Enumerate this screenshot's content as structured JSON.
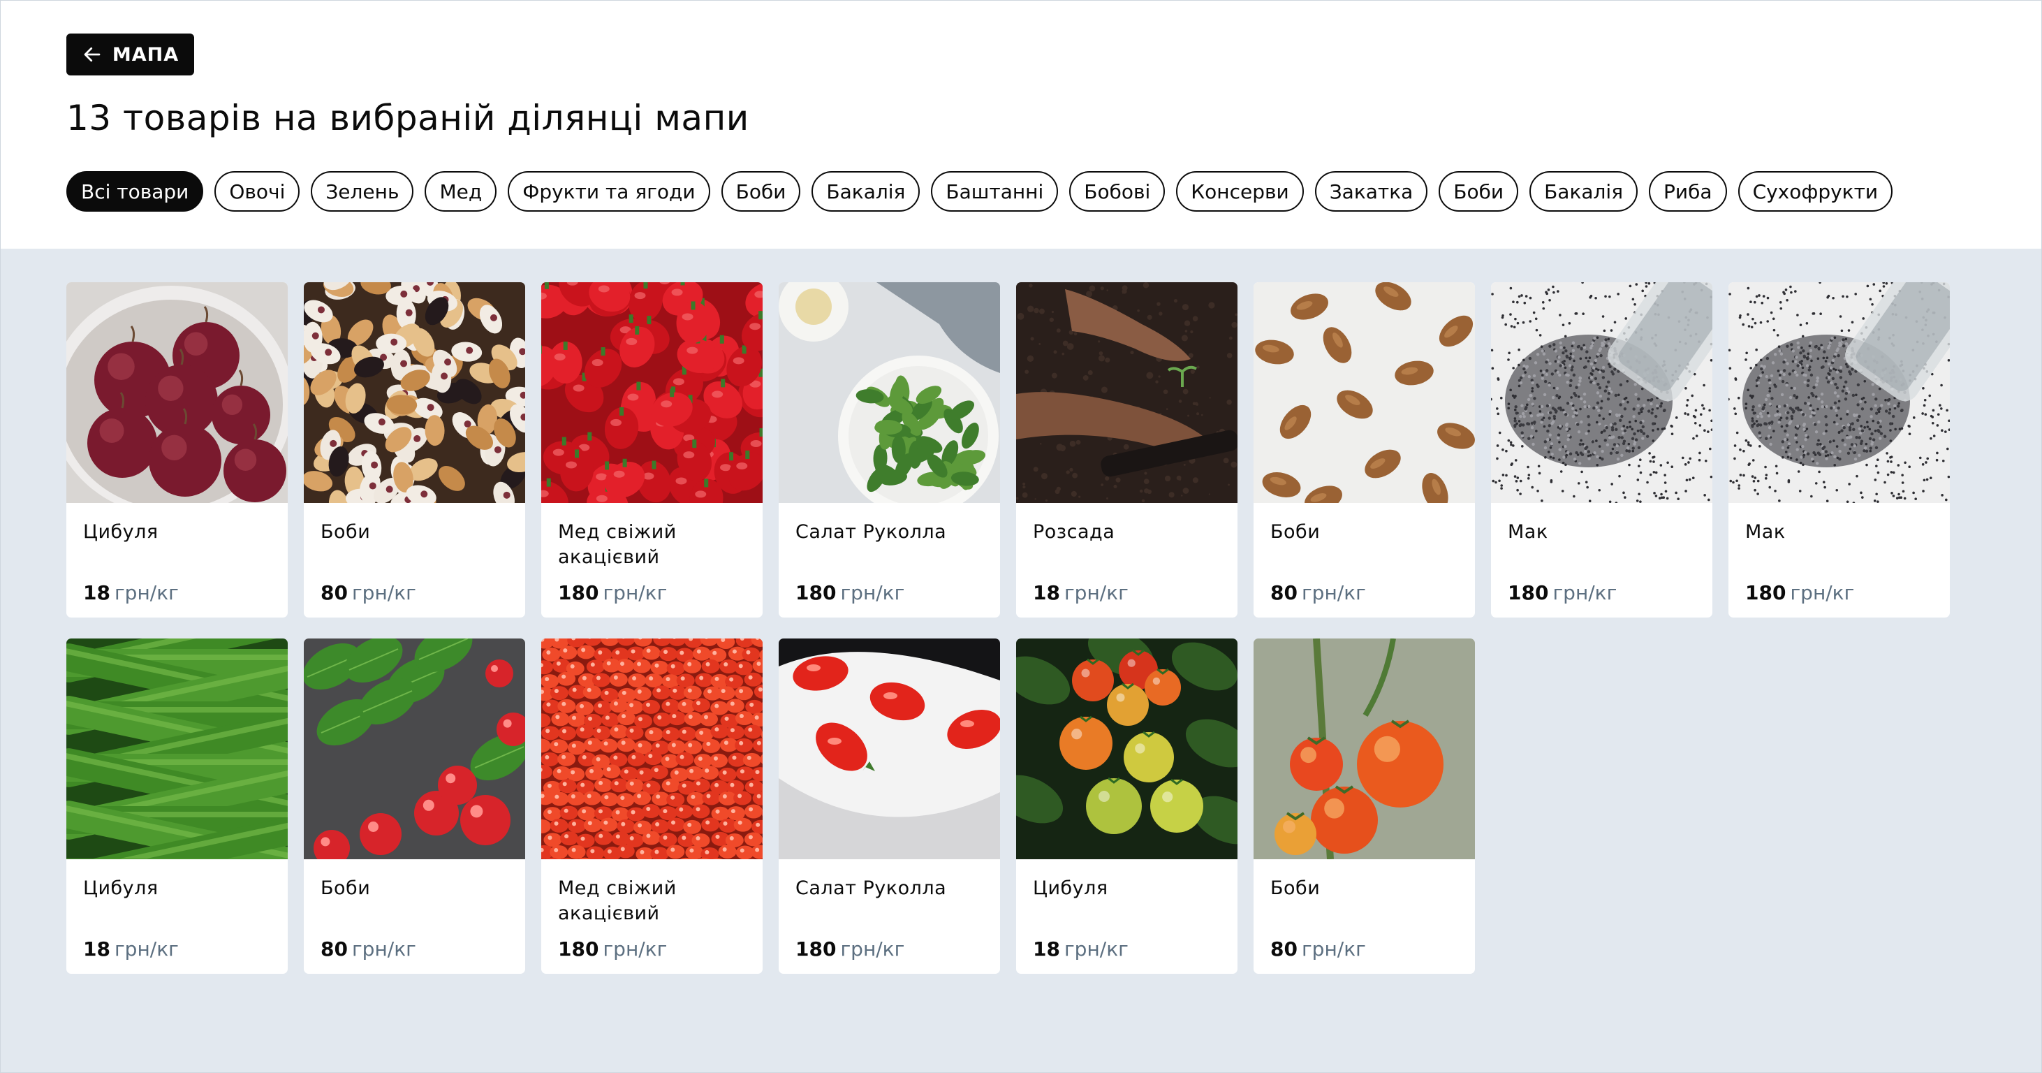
{
  "header": {
    "back_label": "МАПА",
    "title": "13 товарів на вибраній ділянці мапи"
  },
  "categories": [
    "Всі товари",
    "Овочі",
    "Зелень",
    "Мед",
    "Фрукти та ягоди",
    "Боби",
    "Бакалія",
    "Баштанні",
    "Бобові",
    "Консерви",
    "Закатка",
    "Боби",
    "Бакалія",
    "Риба",
    "Сухофрукти"
  ],
  "active_category": "Всі товари",
  "products": [
    {
      "name": "Цибуля",
      "price": "18",
      "unit": "грн/кг",
      "image": "red-onions"
    },
    {
      "name": "Боби",
      "price": "80",
      "unit": "грн/кг",
      "image": "mixed-beans"
    },
    {
      "name": "Мед свіжий акацієвий",
      "price": "180",
      "unit": "грн/кг",
      "image": "red-peppers"
    },
    {
      "name": "Салат Руколла",
      "price": "180",
      "unit": "грн/кг",
      "image": "salad-plate"
    },
    {
      "name": "Розсада",
      "price": "18",
      "unit": "грн/кг",
      "image": "seedling-soil"
    },
    {
      "name": "Боби",
      "price": "80",
      "unit": "грн/кг",
      "image": "almonds"
    },
    {
      "name": "Мак",
      "price": "180",
      "unit": "грн/кг",
      "image": "poppy-seeds"
    },
    {
      "name": "Мак",
      "price": "180",
      "unit": "грн/кг",
      "image": "poppy-seeds"
    },
    {
      "name": "Цибуля",
      "price": "18",
      "unit": "грн/кг",
      "image": "cucumbers"
    },
    {
      "name": "Боби",
      "price": "80",
      "unit": "грн/кг",
      "image": "basil-tomatoes"
    },
    {
      "name": "Мед свіжий акацієвий",
      "price": "180",
      "unit": "грн/кг",
      "image": "cherry-tomatoes"
    },
    {
      "name": "Салат Руколла",
      "price": "180",
      "unit": "грн/кг",
      "image": "plum-tomatoes-plate"
    },
    {
      "name": "Цибуля",
      "price": "18",
      "unit": "грн/кг",
      "image": "tomato-vine"
    },
    {
      "name": "Боби",
      "price": "80",
      "unit": "грн/кг",
      "image": "tomatoes-ripening"
    }
  ]
}
